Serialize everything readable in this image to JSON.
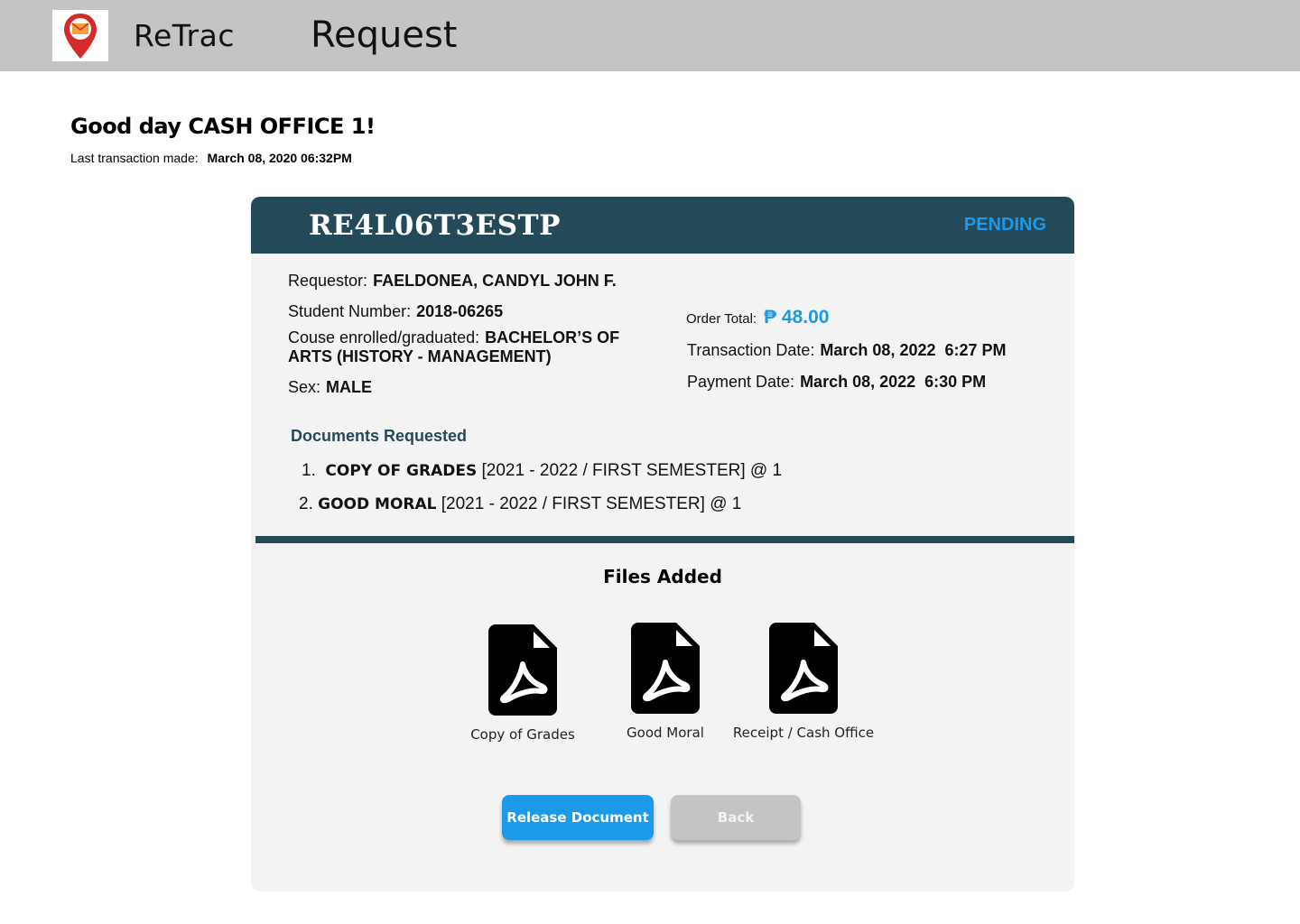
{
  "app": {
    "name": "ReTrac",
    "page_title": "Request"
  },
  "greeting": "Good day CASH OFFICE 1!",
  "last_transaction": {
    "label": "Last transaction made:",
    "value": "March 08, 2020 06:32PM"
  },
  "request": {
    "reference": "RE4L06T3ESTP",
    "status": "PENDING",
    "requestor": {
      "label": "Requestor:",
      "value": "FAELDONEA, CANDYL JOHN F."
    },
    "student_number": {
      "label": "Student Number:",
      "value": "2018-06265"
    },
    "course": {
      "label": "Couse enrolled/graduated:",
      "value": "BACHELOR’S OF ARTS (HISTORY - MANAGEMENT)"
    },
    "sex": {
      "label": "Sex:",
      "value": "MALE"
    },
    "order_total": {
      "label": "Order Total:",
      "value": "₱ 48.00"
    },
    "transaction_date": {
      "label": "Transaction Date:",
      "value": "March 08, 2022  6:27 PM"
    },
    "payment_date": {
      "label": "Payment Date:",
      "value": "March 08, 2022  6:30 PM"
    }
  },
  "documents": {
    "title": "Documents Requested",
    "items": [
      {
        "number": "1.",
        "name": "COPY OF GRADES",
        "details": "[2021 - 2022 / FIRST SEMESTER] @ 1"
      },
      {
        "number": "2.",
        "name": "GOOD MORAL",
        "details": "[2021 - 2022 / FIRST SEMESTER] @ 1"
      }
    ]
  },
  "files": {
    "title": "Files Added",
    "items": [
      {
        "label": "Copy of Grades",
        "icon": "pdf-file-icon"
      },
      {
        "label": "Good Moral",
        "icon": "pdf-file-icon"
      },
      {
        "label": "Receipt / Cash Office",
        "icon": "pdf-file-icon"
      }
    ]
  },
  "actions": {
    "release": "Release Document",
    "back": "Back"
  },
  "colors": {
    "header_bar": "#c4c4c4",
    "card_header": "#244a5a",
    "accent": "#1a9ae8",
    "card_bg": "#f3f3f3",
    "back_button": "#c4c4c4"
  },
  "logo_icon": "location-pin-mail-icon"
}
